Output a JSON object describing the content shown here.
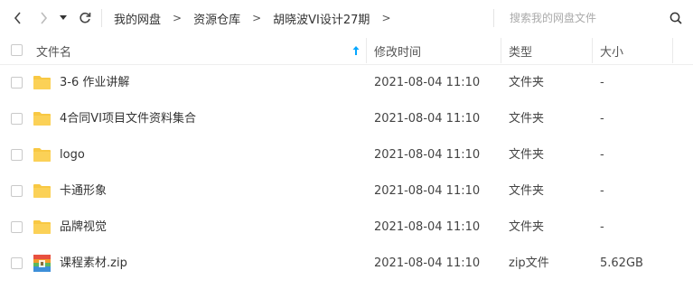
{
  "toolbar": {
    "breadcrumb": [
      "我的网盘",
      "资源仓库",
      "胡晓波VI设计27期"
    ],
    "separator": ">",
    "search_placeholder": "搜索我的网盘文件"
  },
  "columns": {
    "name": "文件名",
    "modified": "修改时间",
    "type": "类型",
    "size": "大小"
  },
  "files": [
    {
      "name": "3-6 作业讲解",
      "modified": "2021-08-04 11:10",
      "type": "文件夹",
      "size": "-",
      "icon": "folder-icon"
    },
    {
      "name": "4合同VI项目文件资料集合",
      "modified": "2021-08-04 11:10",
      "type": "文件夹",
      "size": "-",
      "icon": "folder-icon"
    },
    {
      "name": "logo",
      "modified": "2021-08-04 11:10",
      "type": "文件夹",
      "size": "-",
      "icon": "folder-icon"
    },
    {
      "name": "卡通形象",
      "modified": "2021-08-04 11:10",
      "type": "文件夹",
      "size": "-",
      "icon": "folder-icon"
    },
    {
      "name": "品牌视觉",
      "modified": "2021-08-04 11:10",
      "type": "文件夹",
      "size": "-",
      "icon": "folder-icon"
    },
    {
      "name": "课程素材.zip",
      "modified": "2021-08-04 11:10",
      "type": "zip文件",
      "size": "5.62GB",
      "icon": "zip-archive-icon"
    }
  ],
  "colors": {
    "folder": "#F8C843",
    "accent": "#06A7FF",
    "text": "#333333"
  }
}
